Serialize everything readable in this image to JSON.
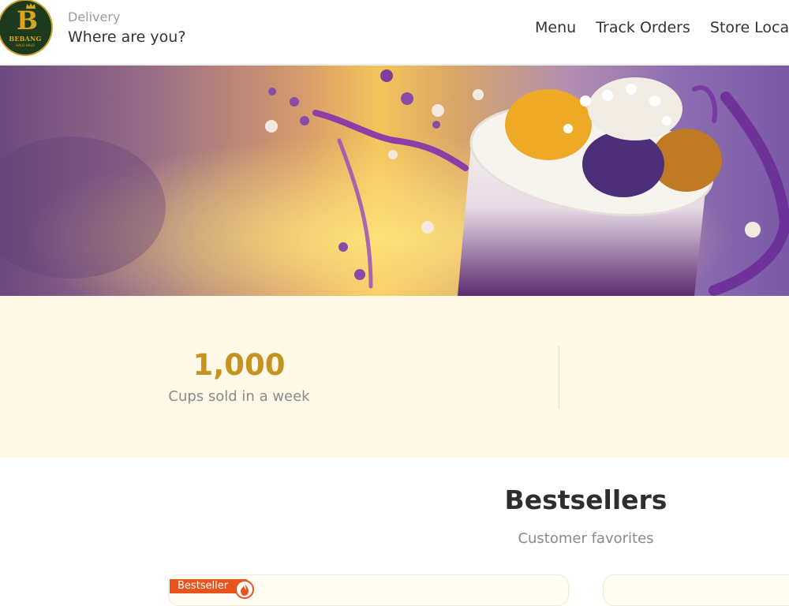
{
  "brand": {
    "logo_text": "BEBANG",
    "logo_subtext": "HALO-HALO"
  },
  "header": {
    "delivery_label": "Delivery",
    "location_prompt": "Where are you?"
  },
  "nav": {
    "items": [
      "Menu",
      "Track Orders",
      "Store Locat"
    ]
  },
  "stats": {
    "value": "1,000",
    "label": "Cups sold in a week"
  },
  "bestsellers": {
    "title": "Bestsellers",
    "subtitle": "Customer favorites",
    "badge": "Bestseller"
  },
  "colors": {
    "accent_gold": "#c69323",
    "badge_orange": "#e8541c",
    "stats_bg": "#fef9e6"
  }
}
